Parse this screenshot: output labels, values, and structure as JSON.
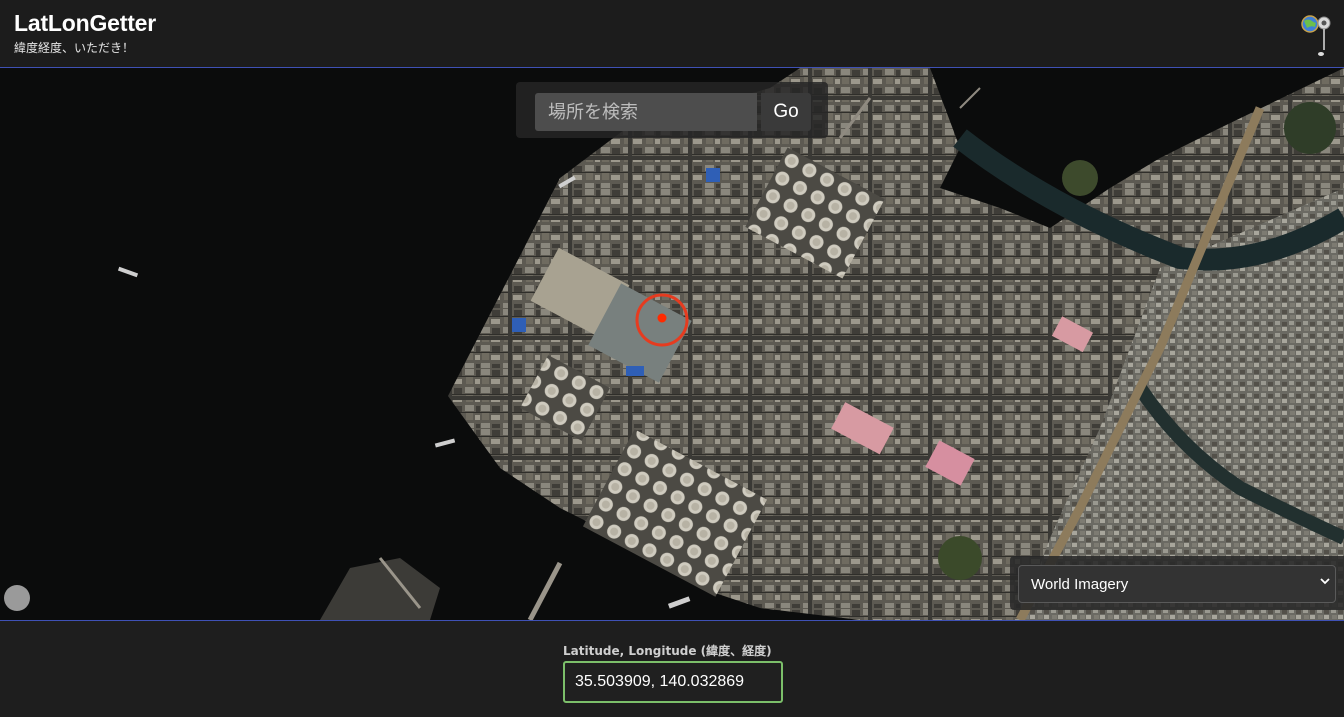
{
  "header": {
    "title": "LatLonGetter",
    "subtitle": "緯度経度、いただき！",
    "icon": "globe-with-pin-icon"
  },
  "map": {
    "imagery": "satellite coastal industrial area",
    "search": {
      "placeholder": "場所を検索",
      "value": "",
      "button_label": "Go"
    },
    "layer_select": {
      "selected": "World Imagery",
      "options": [
        "World Imagery"
      ]
    },
    "target_marker": "crosshair-circle-icon",
    "locate_control": "location-dot-icon",
    "colors": {
      "marker_ring": "#e63b1f",
      "marker_dot": "#ff2a00"
    }
  },
  "footer": {
    "coord_label": "Latitude, Longitude (緯度、経度)",
    "coord_value": "35.503909, 140.032869",
    "accent_border": "#7cbf6a"
  }
}
